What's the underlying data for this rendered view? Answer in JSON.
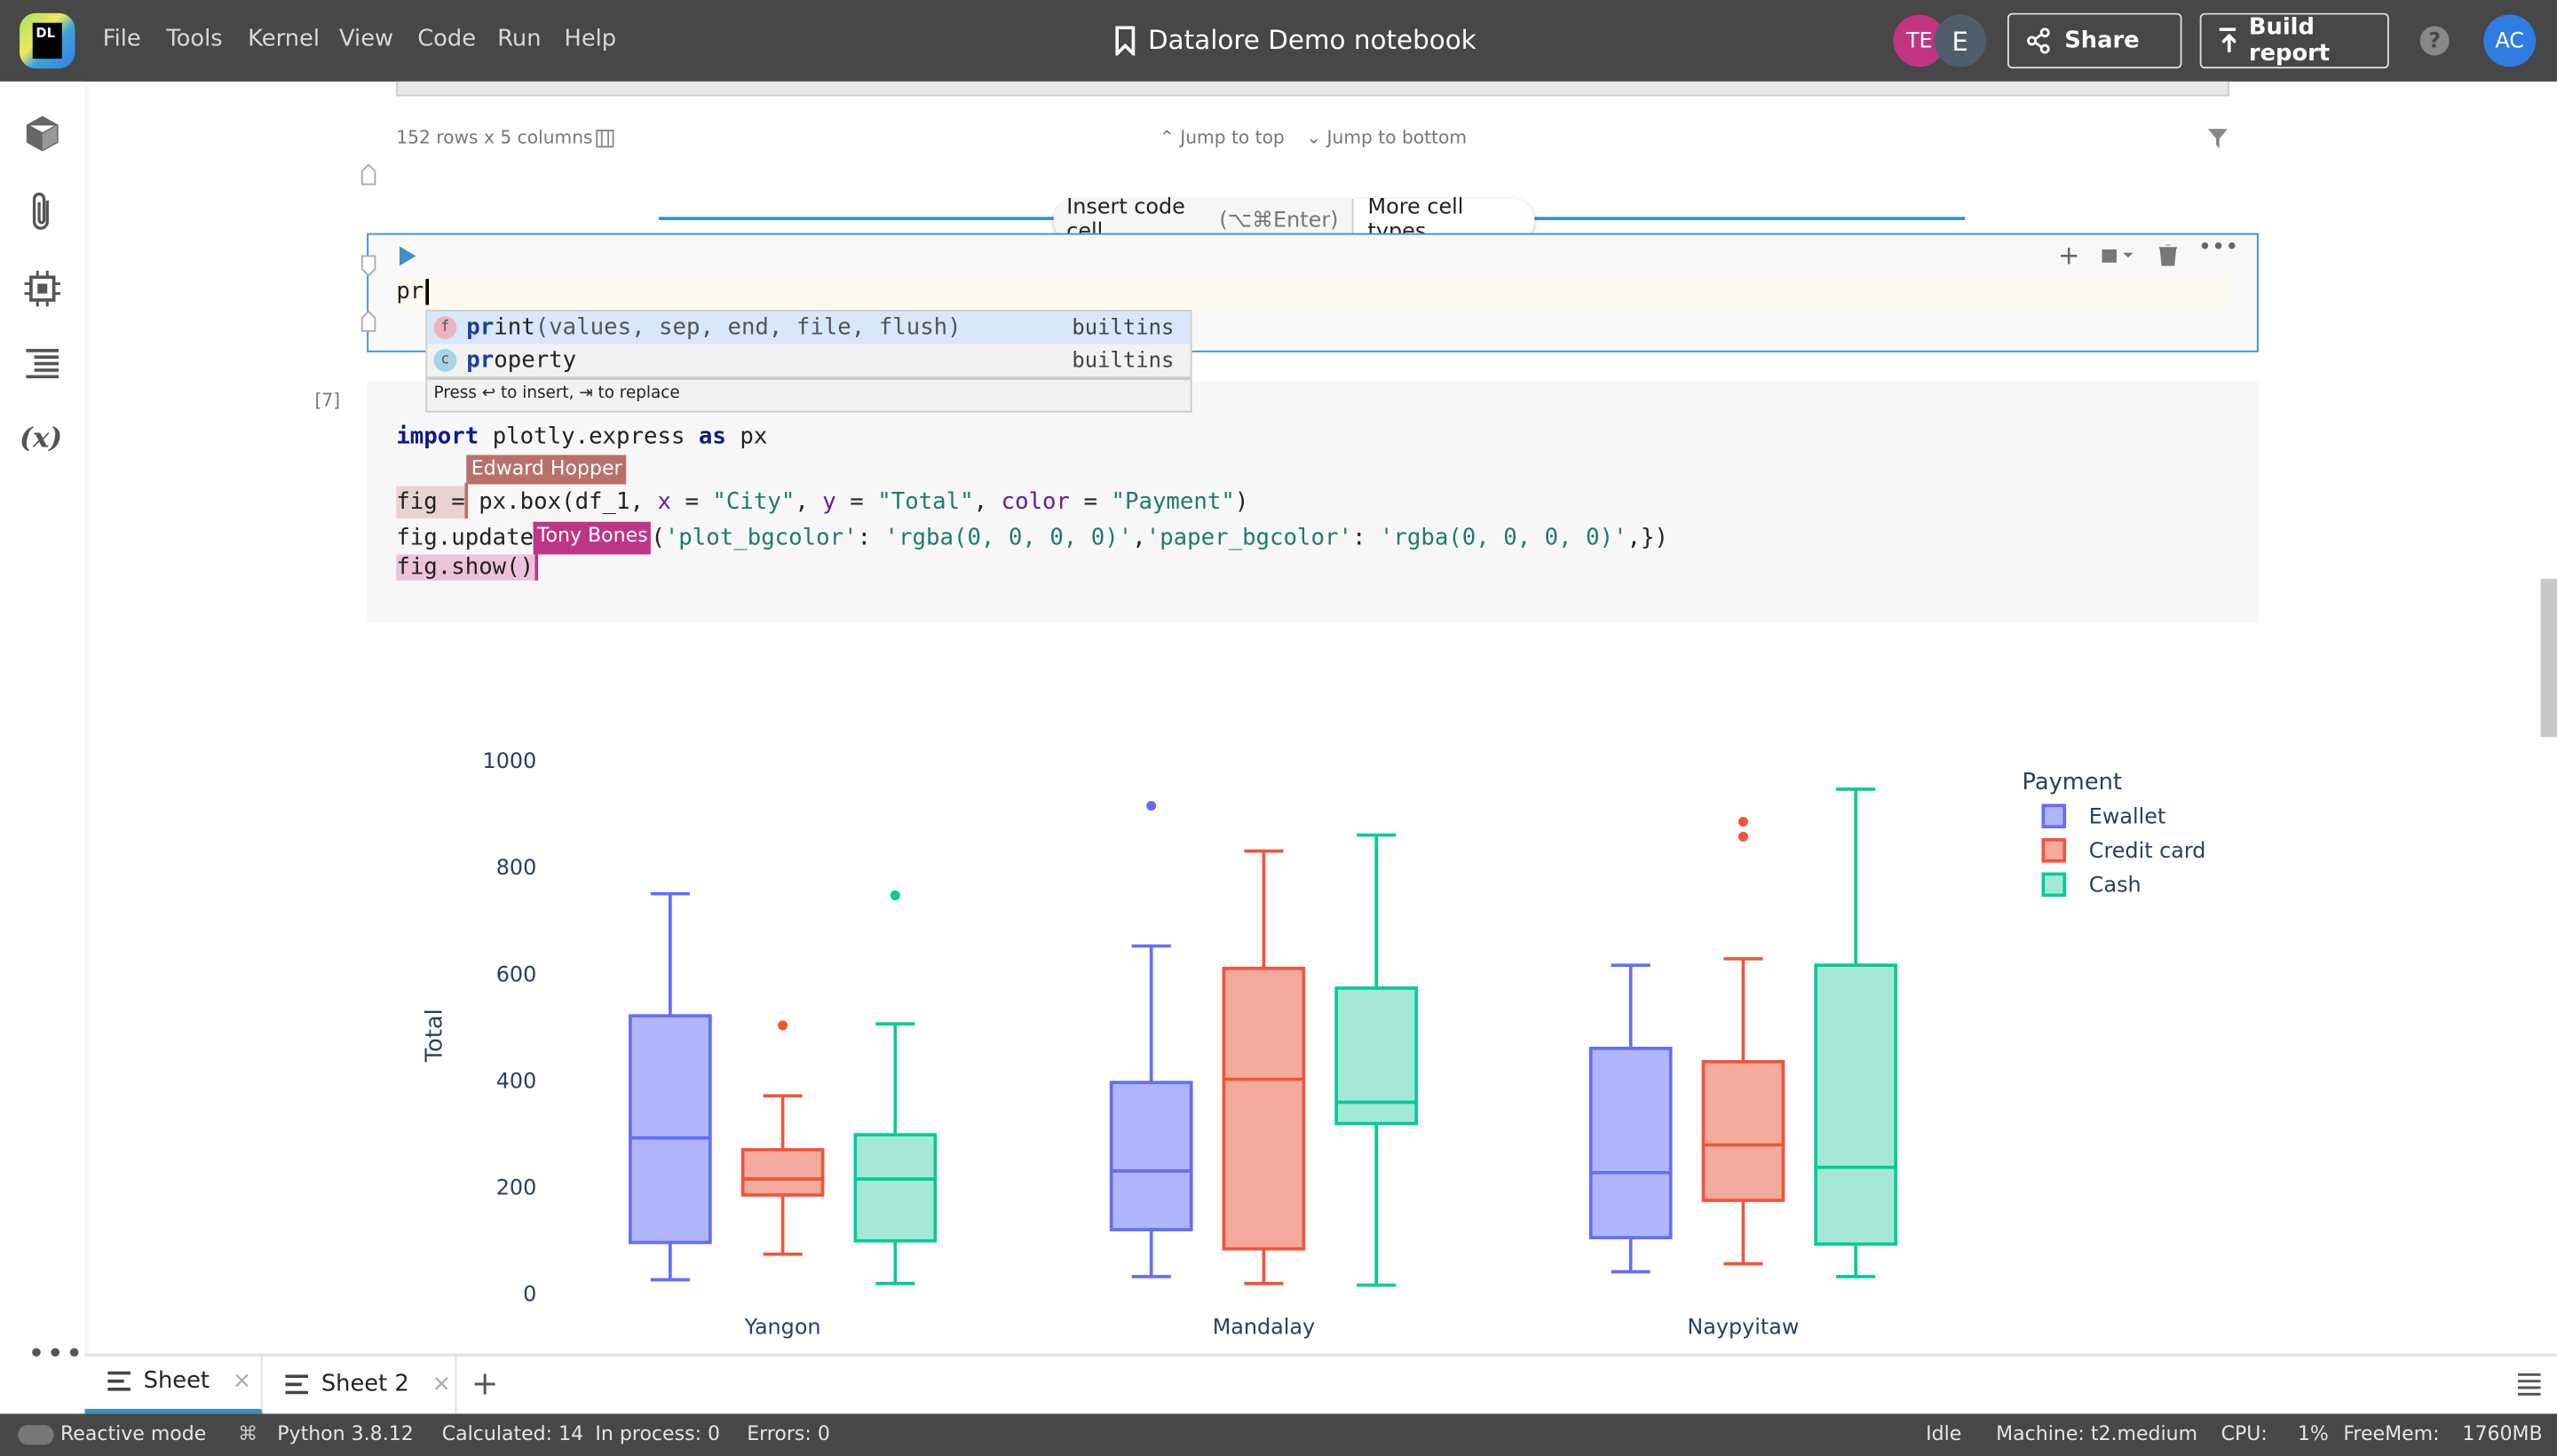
{
  "app": {
    "logo_text": "DL",
    "menu": [
      "File",
      "Tools",
      "Kernel",
      "View",
      "Code",
      "Run",
      "Help"
    ],
    "title": "Datalore Demo notebook",
    "collaborators": [
      {
        "initials": "TE",
        "color": "#c2347f"
      },
      {
        "initials": "E",
        "color": "#4f5d6b"
      }
    ],
    "share_label": "Share",
    "build_report_label": "Build report",
    "user_initials": "AC",
    "user_color": "#2f7de1"
  },
  "sidebar": {
    "icons": [
      "cube-icon",
      "paperclip-icon",
      "chip-icon",
      "outline-icon",
      "variables-icon",
      "more-icon"
    ],
    "variables_glyph": "(x)"
  },
  "table_footer": {
    "summary": "152 rows x 5 columns",
    "jump_top": "Jump to top",
    "jump_bottom": "Jump to bottom"
  },
  "insert_bar": {
    "insert_label": "Insert code cell",
    "insert_shortcut": "(⌥⌘Enter)",
    "more_label": "More cell types"
  },
  "active_cell": {
    "text": "pr",
    "autocomplete": [
      {
        "badge": "f",
        "match": "pr",
        "rest": "int",
        "sig": "(values, sep, end, file, flush)",
        "source": "builtins",
        "selected": true
      },
      {
        "badge": "c",
        "match": "pr",
        "rest": "operty",
        "sig": "",
        "source": "builtins",
        "selected": false
      }
    ],
    "hint": "Press ↩ to insert, ⇥ to replace"
  },
  "code_cell": {
    "exec_count": "[7]",
    "lines": {
      "l1": [
        "import",
        " plotly.express ",
        "as",
        " px"
      ],
      "l2": [
        "fig = px.box(df_1, ",
        "x",
        " = ",
        "\"City\"",
        ", ",
        "y",
        " = ",
        "\"Total\"",
        ", ",
        "color",
        " = ",
        "\"Payment\"",
        ")"
      ],
      "l3": [
        "fig.update",
        "(",
        "'plot_bgcolor'",
        ": ",
        "'rgba(0, 0, 0, 0)'",
        ",",
        "'paper_bgcolor'",
        ": ",
        "'rgba(0, 0, 0, 0)'",
        ",})"
      ],
      "l4": [
        "fig.show()"
      ]
    },
    "cursors": [
      {
        "name": "Edward Hopper",
        "color": "#b9706b"
      },
      {
        "name": "Tony Bones",
        "color": "#bf3585"
      }
    ]
  },
  "chart_data": {
    "type": "box",
    "ylabel": "Total",
    "categories": [
      "Yangon",
      "Mandalay",
      "Naypyitaw"
    ],
    "yticks": [
      0,
      200,
      400,
      600,
      800,
      1000
    ],
    "ylim": [
      0,
      1000
    ],
    "legend_title": "Payment",
    "legend_position": "top-right",
    "series": [
      {
        "name": "Ewallet",
        "color": "#636efa",
        "fill": "#b1b6fc",
        "boxes": [
          {
            "min": 28,
            "q1": 98,
            "median": 294,
            "q3": 523,
            "max": 752,
            "outliers": []
          },
          {
            "min": 34,
            "q1": 122,
            "median": 232,
            "q3": 398,
            "max": 654,
            "outliers": [
              917
            ]
          },
          {
            "min": 43,
            "q1": 107,
            "median": 229,
            "q3": 462,
            "max": 618,
            "outliers": []
          }
        ]
      },
      {
        "name": "Credit card",
        "color": "#ef553b",
        "fill": "#f4aa9d",
        "boxes": [
          {
            "min": 76,
            "q1": 187,
            "median": 217,
            "q3": 272,
            "max": 373,
            "outliers": [
              505
            ]
          },
          {
            "min": 21,
            "q1": 86,
            "median": 404,
            "q3": 612,
            "max": 832,
            "outliers": []
          },
          {
            "min": 58,
            "q1": 177,
            "median": 281,
            "q3": 437,
            "max": 630,
            "outliers": [
              887,
              859
            ]
          }
        ]
      },
      {
        "name": "Cash",
        "color": "#00cc96",
        "fill": "#a6e8d6",
        "boxes": [
          {
            "min": 21,
            "q1": 101,
            "median": 217,
            "q3": 300,
            "max": 508,
            "outliers": [
              749
            ]
          },
          {
            "min": 18,
            "q1": 321,
            "median": 361,
            "q3": 575,
            "max": 862,
            "outliers": []
          },
          {
            "min": 34,
            "q1": 95,
            "median": 239,
            "q3": 618,
            "max": 948,
            "outliers": []
          }
        ]
      }
    ]
  },
  "sheets": {
    "tabs": [
      "Sheet",
      "Sheet 2"
    ],
    "active": 0,
    "add": "+"
  },
  "status": {
    "reactive": "Reactive mode",
    "python": "Python 3.8.12",
    "calculated": "Calculated: 14",
    "in_process": "In process: 0",
    "errors": "Errors: 0",
    "state": "Idle",
    "machine": "Machine: t2.medium",
    "cpu_label": "CPU:",
    "cpu": "1%",
    "mem_label": "FreeMem:",
    "mem": "1760MB"
  }
}
